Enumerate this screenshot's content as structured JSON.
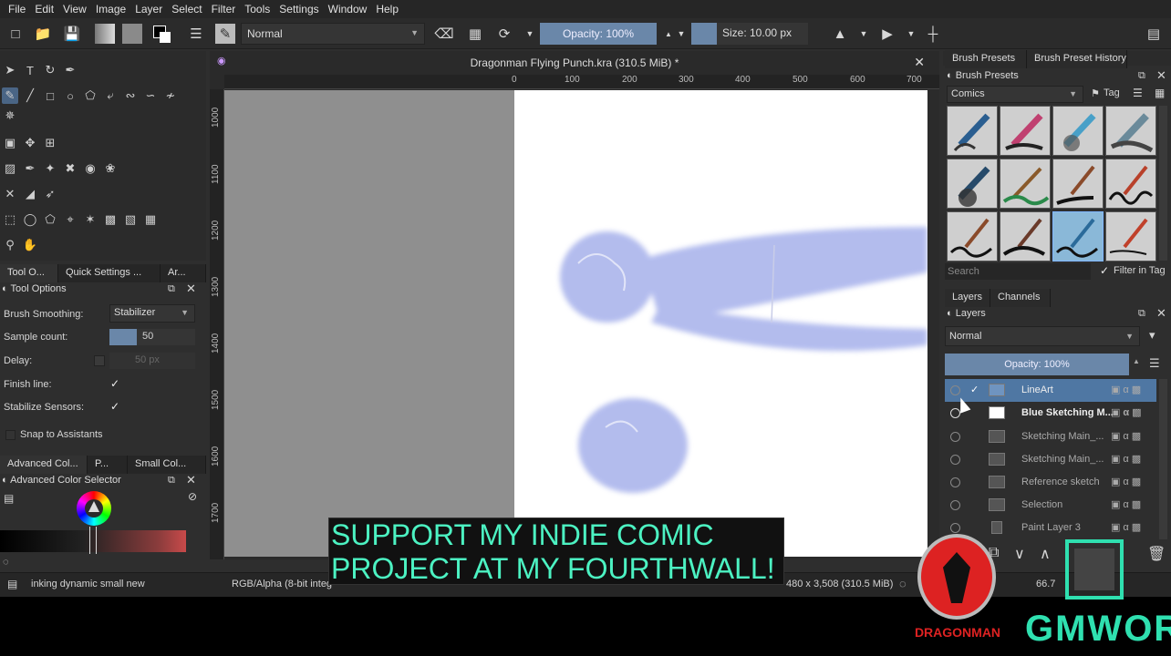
{
  "menu": [
    "File",
    "Edit",
    "View",
    "Image",
    "Layer",
    "Select",
    "Filter",
    "Tools",
    "Settings",
    "Window",
    "Help"
  ],
  "toolbar": {
    "blend_mode": "Normal",
    "opacity": "Opacity: 100%",
    "size": "Size: 10.00 px"
  },
  "tool_options": {
    "tabs": [
      "Tool O...",
      "Quick Settings ...",
      "Ar..."
    ],
    "title": "Tool Options",
    "brush_smoothing_label": "Brush Smoothing:",
    "brush_smoothing_value": "Stabilizer",
    "sample_count_label": "Sample count:",
    "sample_count_value": "50",
    "delay_label": "Delay:",
    "delay_value": "50 px",
    "finish_line_label": "Finish line:",
    "stabilize_sensors_label": "Stabilize Sensors:",
    "snap_label": "Snap to Assistants"
  },
  "color_panel": {
    "tabs": [
      "Advanced Col...",
      "P...",
      "Small Col..."
    ],
    "title": "Advanced Color Selector"
  },
  "document": {
    "title": "Dragonman Flying Punch.kra (310.5 MiB) *",
    "ruler_h": [
      "0",
      "100",
      "200",
      "300",
      "400",
      "500",
      "600",
      "700"
    ],
    "ruler_v": [
      "1000",
      "1100",
      "1200",
      "1300",
      "1400",
      "1500",
      "1600",
      "1700"
    ]
  },
  "brush_presets": {
    "tabs": [
      "Brush Presets",
      "Brush Preset History"
    ],
    "title": "Brush Presets",
    "tag_value": "Comics",
    "tag_label": "Tag",
    "search_placeholder": "Search",
    "filter_label": "Filter in Tag"
  },
  "layers_panel": {
    "tabs": [
      "Layers",
      "Channels"
    ],
    "title": "Layers",
    "blend_mode": "Normal",
    "opacity": "Opacity:  100%",
    "layers": [
      {
        "name": "LineArt"
      },
      {
        "name": "Blue Sketching M..."
      },
      {
        "name": "Sketching Main_..."
      },
      {
        "name": "Sketching Main_..."
      },
      {
        "name": "Reference sketch"
      },
      {
        "name": "Selection"
      },
      {
        "name": "Paint Layer 3"
      }
    ]
  },
  "status": {
    "brush": "inking dynamic small new",
    "color_space": "RGB/Alpha (8-bit integ",
    "dimensions": "480 x 3,508 (310.5 MiB)",
    "zoom": "66.7"
  },
  "overlay": {
    "banner_line1": "SUPPORT MY INDIE COMIC",
    "banner_line2": "PROJECT AT MY FOURTHWALL!",
    "logo_left": "DRAGONMAN",
    "logo_right": "GMWOR"
  },
  "colors": {
    "accent": "#6a87a9",
    "selected_layer": "#4f77a3",
    "sketch": "#9aa6e8",
    "banner_text": "#4cf2c2"
  }
}
